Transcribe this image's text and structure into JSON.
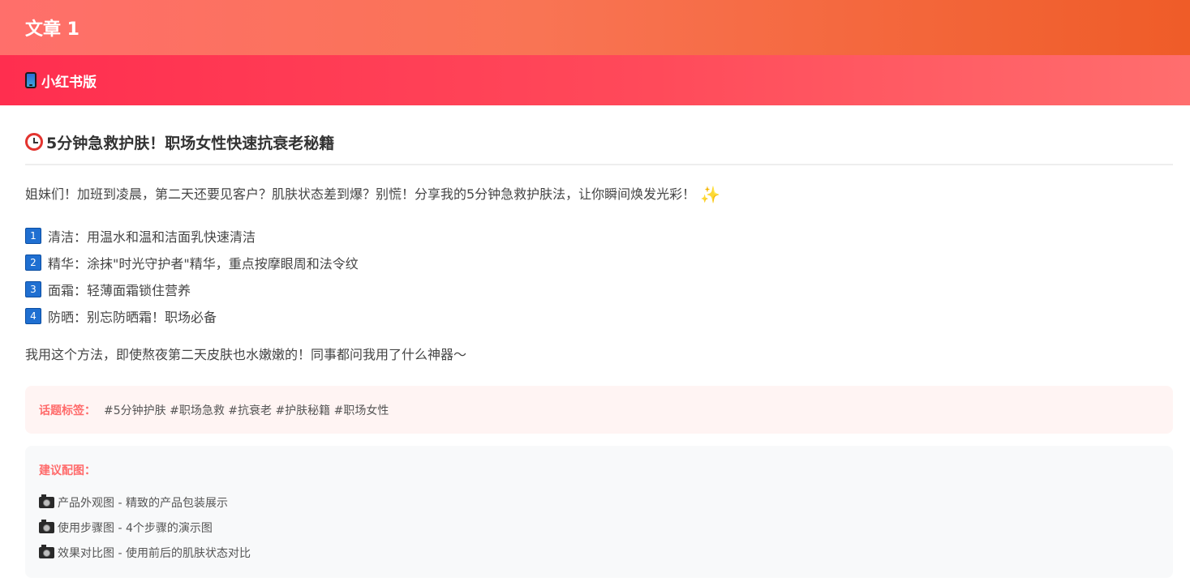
{
  "header": {
    "title": "文章 1"
  },
  "platform": {
    "label": "小红书版",
    "icon": "mobile-phone-icon"
  },
  "article": {
    "title": "5分钟急救护肤！职场女性快速抗衰老秘籍",
    "title_icon": "alarm-clock-icon",
    "intro": "姐妹们！加班到凌晨，第二天还要见客户？肌肤状态差到爆？别慌！分享我的5分钟急救护肤法，让你瞬间焕发光彩！",
    "intro_icon": "sparkles-icon",
    "steps": [
      {
        "num": "1",
        "text": "清洁：用温水和温和洁面乳快速清洁"
      },
      {
        "num": "2",
        "text": "精华：涂抹\"时光守护者\"精华，重点按摩眼周和法令纹"
      },
      {
        "num": "3",
        "text": "面霜：轻薄面霜锁住营养"
      },
      {
        "num": "4",
        "text": "防晒：别忘防晒霜！职场必备"
      }
    ],
    "outro": "我用这个方法，即使熬夜第二天皮肤也水嫩嫩的！同事都问我用了什么神器～"
  },
  "tags": {
    "label": "话题标签：",
    "text": "#5分钟护肤 #职场急救 #抗衰老 #护肤秘籍 #职场女性"
  },
  "images": {
    "label": "建议配图：",
    "items": [
      "产品外观图 - 精致的产品包装展示",
      "使用步骤图 - 4个步骤的演示图",
      "效果对比图 - 使用前后的肌肤状态对比"
    ]
  },
  "colors": {
    "header_gradient_start": "#ff6f6b",
    "header_gradient_end": "#ef5c28",
    "platform_gradient_start": "#ff2e4f",
    "platform_gradient_end": "#ff6e6e",
    "accent_label": "#ff6b6b",
    "tags_bg": "#fff4f3",
    "images_bg": "#f8f9fa"
  }
}
